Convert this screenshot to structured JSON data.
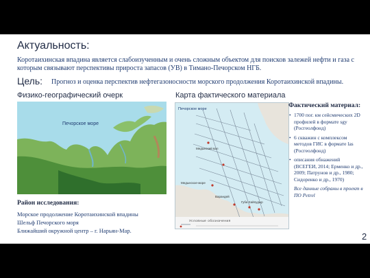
{
  "slide": {
    "title": "Актуальность:",
    "intro": "Коротаихинская впадина является слабоизученным и очень сложным объектом для поисков залежей нефти и газа с которым связывают перспективы прироста запасов (УВ) в Тимано-Печорском НГБ.",
    "goal_label": "Цель:",
    "goal_text": "Прогноз и оценка перспектив нефтегазоносности морского продолжения Коротаихинской впадины.",
    "left_heading": "Физико-географический очерк",
    "mid_heading": "Карта фактического материала",
    "page_number": "2"
  },
  "geo_map": {
    "sea_label": "Печорское море"
  },
  "fact_map": {
    "sea_label": "Печорское море",
    "places": [
      "Медынский вал",
      "Медынское-море",
      "Варандей",
      "Губа Хайпудыр"
    ],
    "legend_title": "Условные обозначения"
  },
  "region": {
    "heading": "Район исследования:",
    "lines": [
      "Морское продолжение Коротаихинской впадины",
      "Шельф Печорского моря",
      "Ближайший окружной центр – г. Нарьян-Мар."
    ]
  },
  "facts": {
    "title": "Фактический материал:",
    "items": [
      "1700 пог. км сейсмических 2D профилей в формате sgy (Росгеолфонд)",
      "6 скважин с комплексом методов ГИС в формате las (Росгеолфонд)",
      "описания обнажений (ВСЕГЕИ, 2014; Ерменко и др., 2009; Патрунов и др., 1980; Сидоренко и др., 1970)"
    ],
    "note": "Все данные собраны в проект в ПО Petrel"
  },
  "colors": {
    "text_dark": "#1f2a44",
    "text_blue": "#1f3b70",
    "sea": "#9fd7e6",
    "land": "#6aa84f"
  }
}
